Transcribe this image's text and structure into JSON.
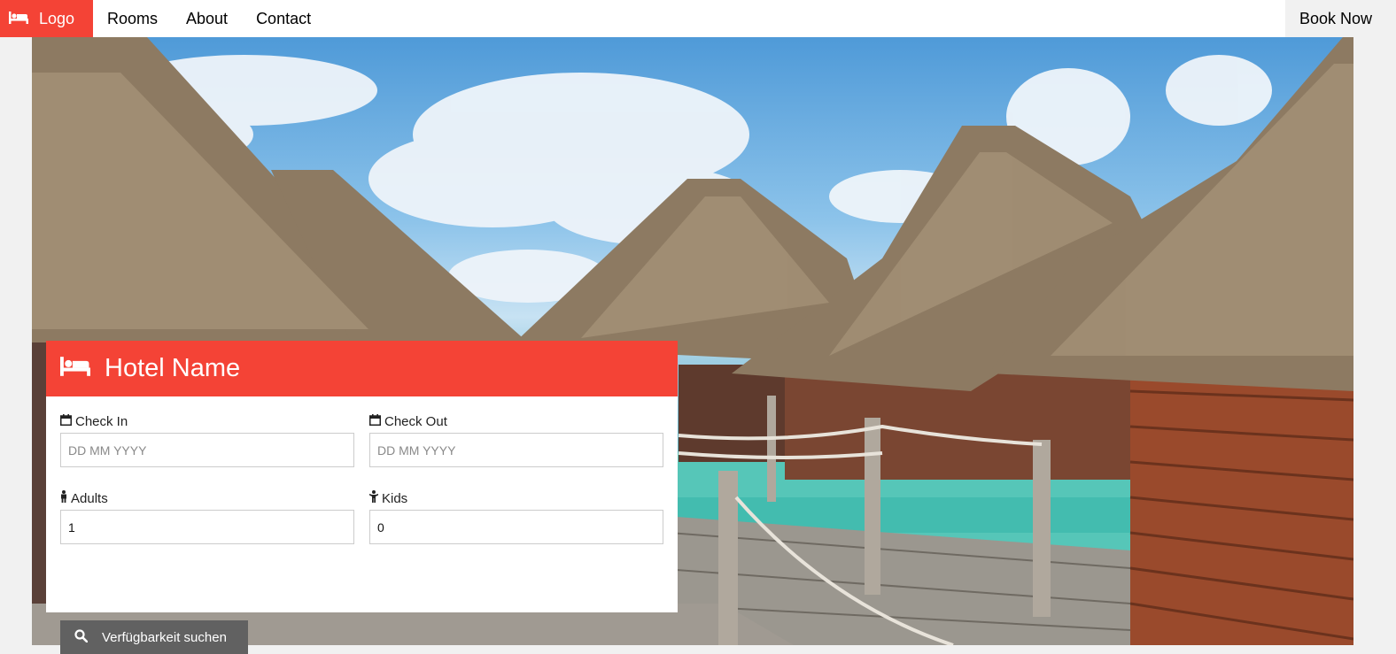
{
  "nav": {
    "logo_label": "Logo",
    "links": [
      "Rooms",
      "About",
      "Contact"
    ],
    "cta_label": "Book Now"
  },
  "card": {
    "title": "Hotel Name",
    "check_in": {
      "label": "Check In",
      "placeholder": "DD MM YYYY"
    },
    "check_out": {
      "label": "Check Out",
      "placeholder": "DD MM YYYY"
    },
    "adults": {
      "label": "Adults",
      "value": "1"
    },
    "kids": {
      "label": "Kids",
      "value": "0"
    },
    "search_label": "Verfügbarkeit suchen"
  },
  "colors": {
    "accent": "#f44336",
    "button": "#616161",
    "page_bg": "#f1f1f1"
  },
  "icons": {
    "logo": "bed-icon",
    "header": "bed-icon",
    "check_in": "calendar-icon",
    "check_out": "calendar-icon",
    "adults": "male-icon",
    "kids": "child-icon",
    "search": "search-icon"
  }
}
